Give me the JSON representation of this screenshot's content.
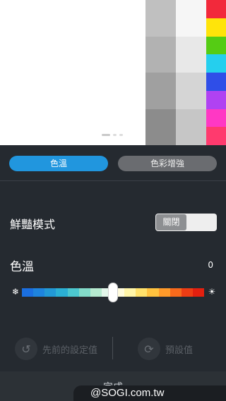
{
  "preview": {
    "gray_column_a": [
      "#c0c0c0",
      "#b2b2b2",
      "#a0a0a0",
      "#8c8c8c"
    ],
    "gray_column_b": [
      "#f6f6f6",
      "#e8e8e8",
      "#d5d5d5",
      "#c6c6c6"
    ],
    "color_column": [
      "#f2293b",
      "#ffe40a",
      "#55cc14",
      "#25cfee",
      "#2f4ee8",
      "#b042f2",
      "#ff38c4",
      "#ff3a6e"
    ]
  },
  "tabs": {
    "color_temp": "色溫",
    "color_enhance": "色彩增強"
  },
  "vivid_mode": {
    "label": "鮮豔模式",
    "toggle_label": "關閉"
  },
  "color_temperature": {
    "label": "色溫",
    "value": "0",
    "cold_icon": "❄",
    "warm_icon": "☀",
    "slider_position": 0.5,
    "gradient": [
      "#1b6fe0",
      "#1e84de",
      "#2299d6",
      "#2bb0d4",
      "#4cc8cf",
      "#83dbc9",
      "#b6ead0",
      "#e2f6ea",
      "#fffbdc",
      "#fff5a8",
      "#ffe16b",
      "#ffc23f",
      "#ff9a2a",
      "#f76a1c",
      "#ee3d14",
      "#e3200f"
    ]
  },
  "actions": {
    "previous_settings": "先前的設定值",
    "default_settings": "預設值",
    "prev_icon": "↺",
    "default_icon": "⟳"
  },
  "footer": {
    "done": "完成",
    "watermark": "@SOGI.com.tw"
  }
}
